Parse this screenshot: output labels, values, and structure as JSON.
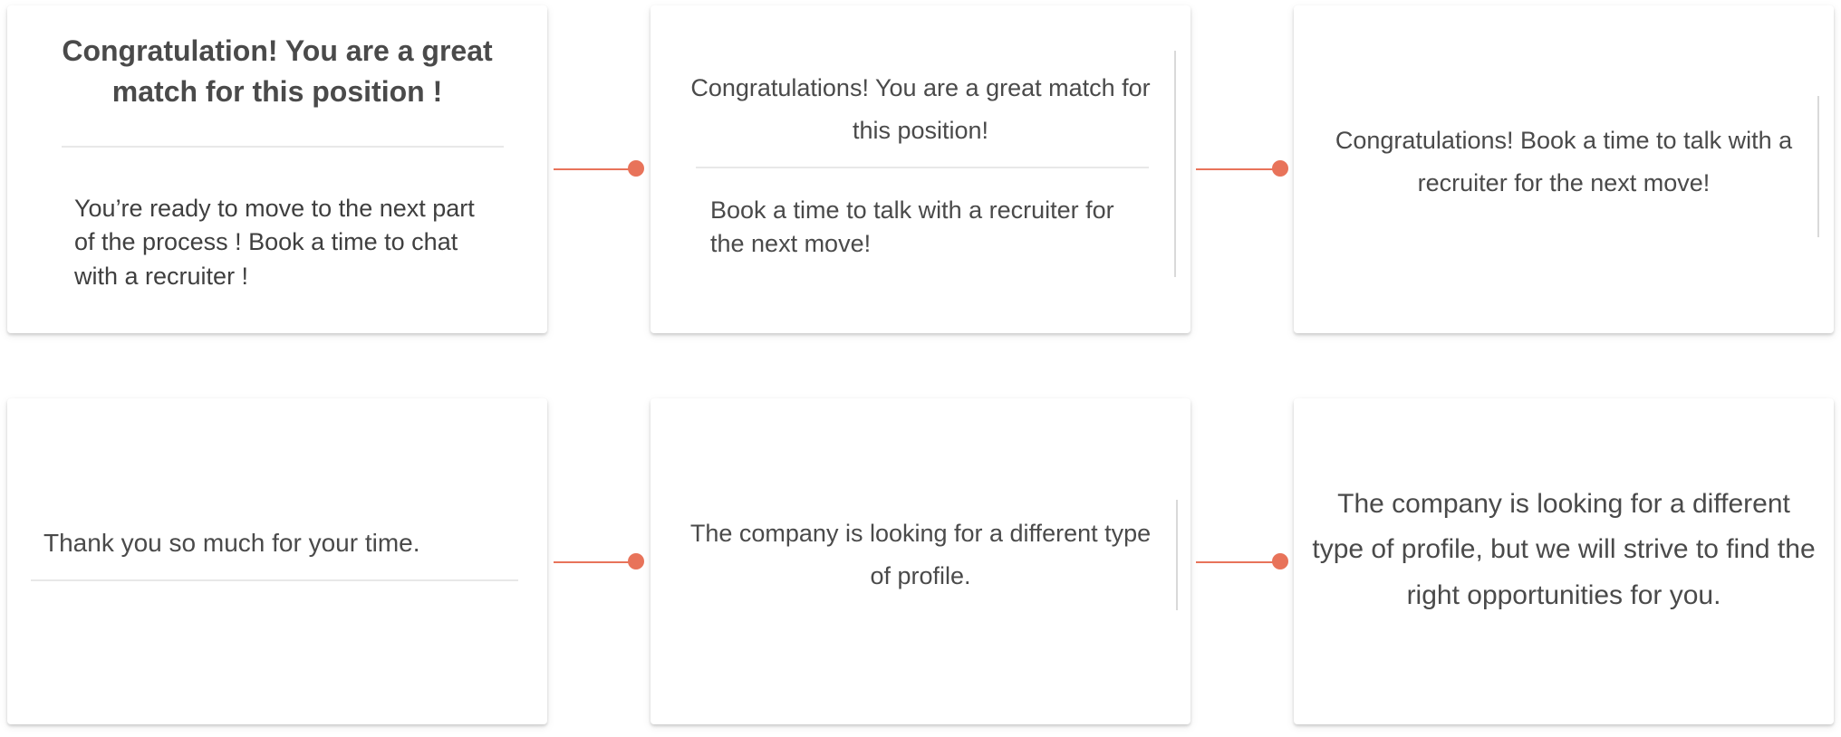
{
  "cards": [
    {
      "title": "Congratulation! You are a great match for this position !",
      "body": "You’re ready to move to the next part of the process ! Book a time to chat with a recruiter !"
    },
    {
      "title": "Congratulations! You are a great match for this position!",
      "body": "Book a time to talk with a recruiter for the next move!"
    },
    {
      "title": "Congratulations! Book a time to talk with a recruiter for the next move!"
    },
    {
      "title": "Thank you so much for your time."
    },
    {
      "title": "The company is looking for a different type of profile."
    },
    {
      "title": "The company is looking for a different type of profile, but we will strive to find the right opportunities for you."
    }
  ],
  "accent_color": "#e8735a"
}
